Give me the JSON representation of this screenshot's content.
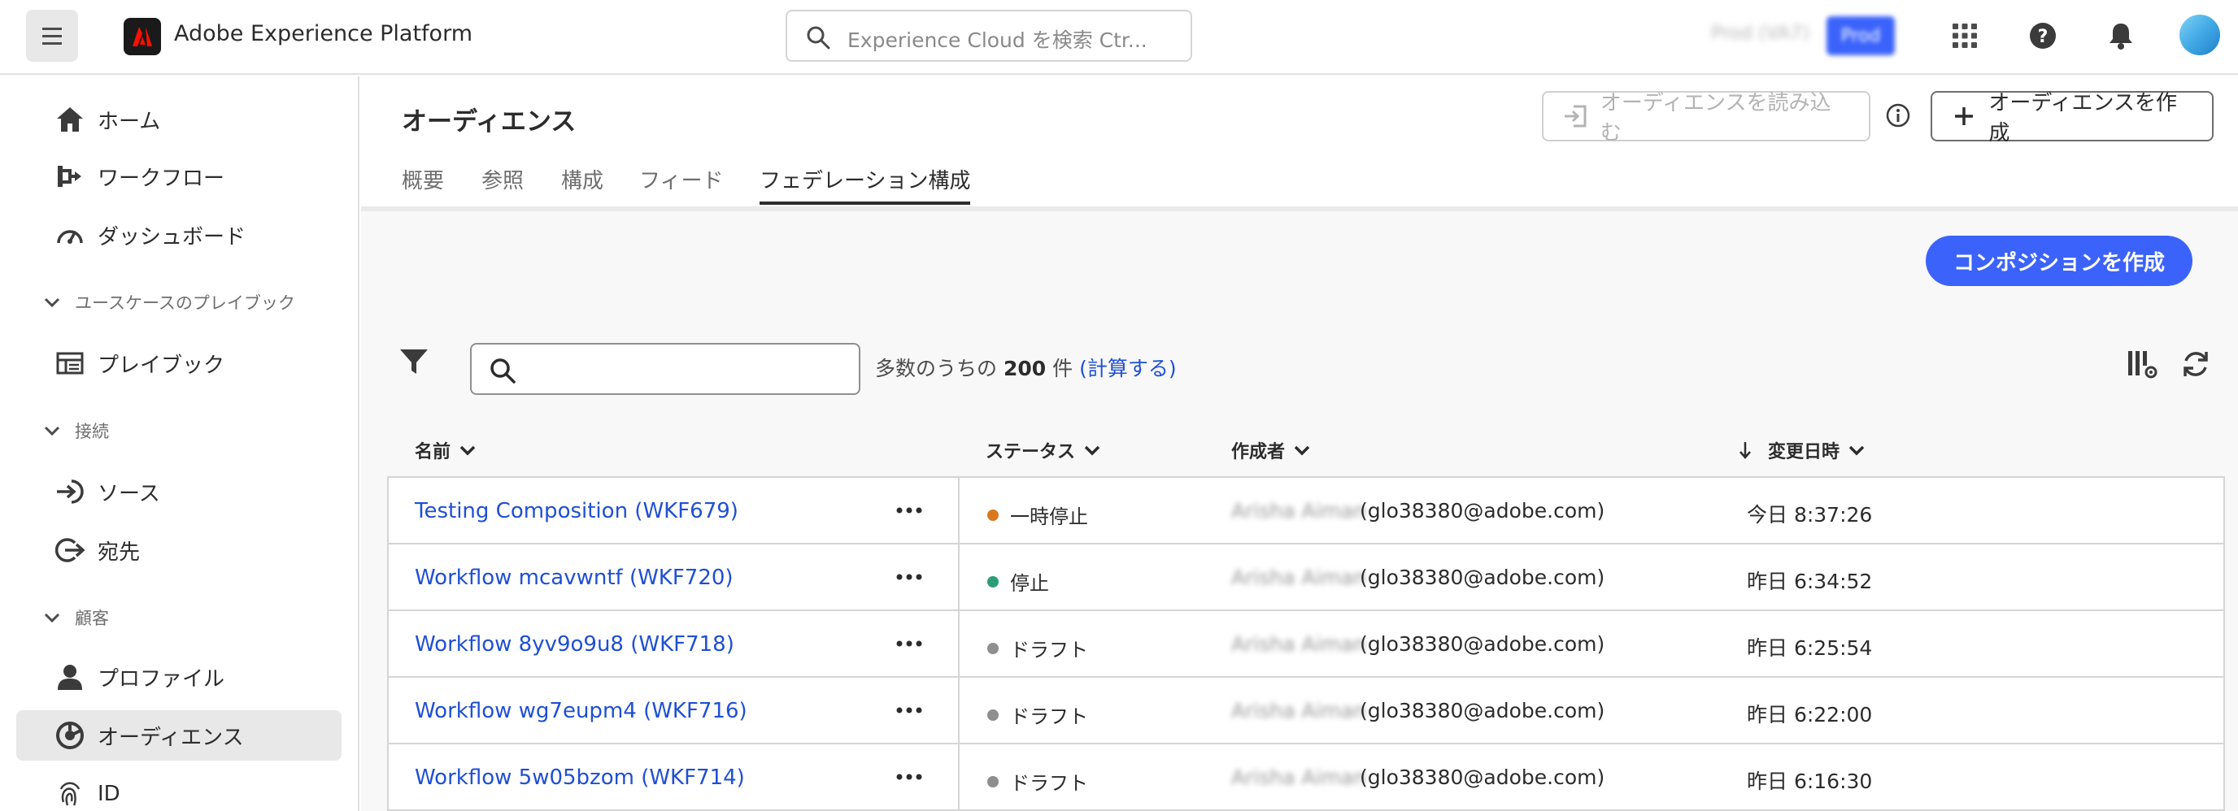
{
  "header": {
    "app_title": "Adobe Experience Platform",
    "search_placeholder": "Experience Cloud を検索 Ctr...",
    "org_name": "Prod (VA7)",
    "sandbox_badge": "Prod"
  },
  "sidebar": {
    "items": [
      {
        "label": "ホーム",
        "icon": "home-icon"
      },
      {
        "label": "ワークフロー",
        "icon": "workflow-icon"
      },
      {
        "label": "ダッシュボード",
        "icon": "dashboard-icon"
      },
      {
        "label": "プレイブック",
        "icon": "playbook-icon"
      },
      {
        "label": "ソース",
        "icon": "sources-icon"
      },
      {
        "label": "宛先",
        "icon": "destinations-icon"
      },
      {
        "label": "プロファイル",
        "icon": "profile-icon"
      },
      {
        "label": "オーディエンス",
        "icon": "audience-icon"
      },
      {
        "label": "ID",
        "icon": "identity-icon"
      }
    ],
    "sections": [
      {
        "label": "ユースケースのプレイブック"
      },
      {
        "label": "接続"
      },
      {
        "label": "顧客"
      }
    ]
  },
  "page": {
    "title": "オーディエンス",
    "tabs": [
      "概要",
      "参照",
      "構成",
      "フィード",
      "フェデレーション構成"
    ],
    "import_button": "オーディエンスを読み込む",
    "create_audience_button": "オーディエンスを作成",
    "create_composition_button": "コンポジションを作成"
  },
  "list": {
    "count_prefix": "多数のうちの",
    "count_value": "200",
    "count_suffix": "件",
    "calc_link": "(計算する)",
    "columns": {
      "name": "名前",
      "status": "ステータス",
      "author": "作成者",
      "modified": "変更日時"
    },
    "rows": [
      {
        "name": "Testing Composition (WKF679)",
        "status": "一時停止",
        "status_color": "#d9781e",
        "author": "Arisha Aiman",
        "email": "(glo38380@adobe.com)",
        "modified": "今日 8:37:26"
      },
      {
        "name": "Workflow mcavwntf (WKF720)",
        "status": "停止",
        "status_color": "#2d9d78",
        "author": "Arisha Aiman",
        "email": "(glo38380@adobe.com)",
        "modified": "昨日 6:34:52"
      },
      {
        "name": "Workflow 8yv9o9u8 (WKF718)",
        "status": "ドラフト",
        "status_color": "#8e8e8e",
        "author": "Arisha Aiman",
        "email": "(glo38380@adobe.com)",
        "modified": "昨日 6:25:54"
      },
      {
        "name": "Workflow wg7eupm4 (WKF716)",
        "status": "ドラフト",
        "status_color": "#8e8e8e",
        "author": "Arisha Aiman",
        "email": "(glo38380@adobe.com)",
        "modified": "昨日 6:22:00"
      },
      {
        "name": "Workflow 5w05bzom (WKF714)",
        "status": "ドラフト",
        "status_color": "#8e8e8e",
        "author": "Arisha Aiman",
        "email": "(glo38380@adobe.com)",
        "modified": "昨日 6:16:30"
      }
    ]
  }
}
